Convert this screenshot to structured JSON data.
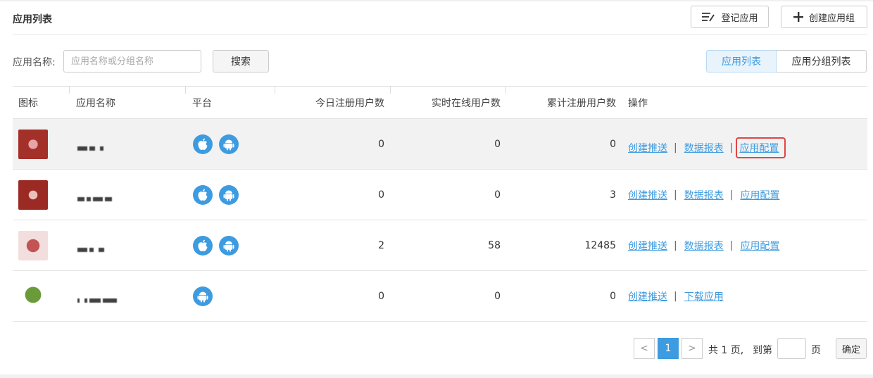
{
  "header": {
    "title": "应用列表",
    "register_label": "登记应用",
    "create_group_label": "创建应用组"
  },
  "filter": {
    "label": "应用名称:",
    "placeholder": "应用名称或分组名称",
    "value": "",
    "search_label": "搜索"
  },
  "view_toggle": {
    "items": [
      {
        "label": "应用列表",
        "active": true
      },
      {
        "label": "应用分组列表",
        "active": false
      }
    ]
  },
  "table": {
    "columns": [
      "图标",
      "应用名称",
      "平台",
      "今日注册用户数",
      "实时在线用户数",
      "累计注册用户数",
      "操作"
    ],
    "rows": [
      {
        "platforms": [
          "ios-icon",
          "android-icon"
        ],
        "today": "0",
        "online": "0",
        "total": "0",
        "ops": [
          "创建推送",
          "数据报表",
          "应用配置"
        ],
        "highlighted": true
      },
      {
        "platforms": [
          "ios-icon",
          "android-icon"
        ],
        "today": "0",
        "online": "0",
        "total": "3",
        "ops": [
          "创建推送",
          "数据报表",
          "应用配置"
        ],
        "highlighted": false
      },
      {
        "platforms": [
          "ios-icon",
          "android-icon"
        ],
        "today": "2",
        "online": "58",
        "total": "12485",
        "ops": [
          "创建推送",
          "数据报表",
          "应用配置"
        ],
        "highlighted": false
      },
      {
        "platforms": [
          "android-icon"
        ],
        "today": "0",
        "online": "0",
        "total": "0",
        "ops": [
          "创建推送",
          "下载应用"
        ],
        "highlighted": false
      }
    ]
  },
  "pagination": {
    "prev": "<",
    "current": "1",
    "next": ">",
    "total_text": "共 1 页,",
    "goto_text": "到第",
    "page_unit": "页",
    "goto_value": "",
    "confirm_label": "确定"
  },
  "colors": {
    "accent": "#3d9be0",
    "highlight_box": "#e04646"
  }
}
